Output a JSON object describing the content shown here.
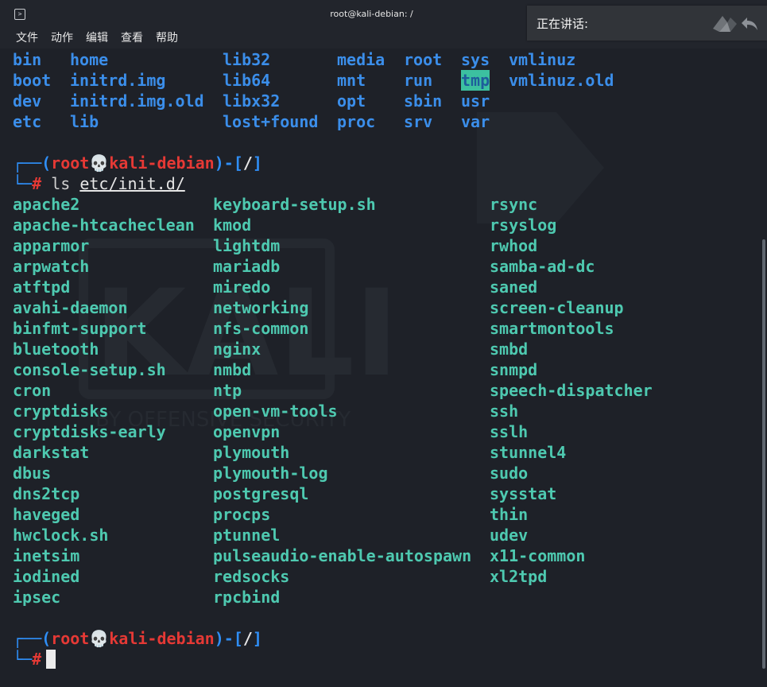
{
  "window": {
    "title": "root@kali-debian: /",
    "menu": [
      "文件",
      "动作",
      "编辑",
      "查看",
      "帮助"
    ],
    "icons": [
      "terminal-icon"
    ]
  },
  "speaking_panel": {
    "label": "正在讲话:",
    "icons": [
      "kali-logo-icon",
      "reply-arrow-icon"
    ]
  },
  "terminal": {
    "root_ls": {
      "rows": [
        [
          "bin",
          "home",
          "lib32",
          "media",
          "root",
          "sys",
          "vmlinuz"
        ],
        [
          "boot",
          "initrd.img",
          "lib64",
          "mnt",
          "run",
          "tmp",
          "vmlinuz.old"
        ],
        [
          "dev",
          "initrd.img.old",
          "libx32",
          "opt",
          "sbin",
          "usr",
          ""
        ],
        [
          "etc",
          "lib",
          "lost+found",
          "proc",
          "srv",
          "var",
          ""
        ]
      ]
    },
    "prompt1": {
      "open": "┌──(",
      "user": "root",
      "skull": "💀",
      "host": "kali-debian",
      "mid": ")-[",
      "dir": "/",
      "close": "]",
      "corner": "└─",
      "hash": "#",
      "cmd": "ls",
      "arg": "etc/init.d/"
    },
    "initd": {
      "col1": [
        "apache2",
        "apache-htcacheclean",
        "apparmor",
        "arpwatch",
        "atftpd",
        "avahi-daemon",
        "binfmt-support",
        "bluetooth",
        "console-setup.sh",
        "cron",
        "cryptdisks",
        "cryptdisks-early",
        "darkstat",
        "dbus",
        "dns2tcp",
        "haveged",
        "hwclock.sh",
        "inetsim",
        "iodined",
        "ipsec"
      ],
      "col2": [
        "keyboard-setup.sh",
        "kmod",
        "lightdm",
        "mariadb",
        "miredo",
        "networking",
        "nfs-common",
        "nginx",
        "nmbd",
        "ntp",
        "open-vm-tools",
        "openvpn",
        "plymouth",
        "plymouth-log",
        "postgresql",
        "procps",
        "ptunnel",
        "pulseaudio-enable-autospawn",
        "redsocks",
        "rpcbind"
      ],
      "col3": [
        "rsync",
        "rsyslog",
        "rwhod",
        "samba-ad-dc",
        "saned",
        "screen-cleanup",
        "smartmontools",
        "smbd",
        "snmpd",
        "speech-dispatcher",
        "ssh",
        "sslh",
        "stunnel4",
        "sudo",
        "sysstat",
        "thin",
        "udev",
        "x11-common",
        "xl2tpd",
        ""
      ]
    },
    "prompt2": {
      "open": "┌──(",
      "user": "root",
      "skull": "💀",
      "host": "kali-debian",
      "mid": ")-[",
      "dir": "/",
      "close": "]",
      "corner": "└─",
      "hash": "#"
    }
  },
  "watermark": {
    "word": "KALI",
    "tagline": "BY OFFENSIVE SECURITY"
  },
  "colors": {
    "background": "#1e2128",
    "directory": "#3b8eea",
    "file": "#4ec9b0",
    "prompt_red": "#e53935",
    "prompt_blue": "#2f8ef6"
  }
}
